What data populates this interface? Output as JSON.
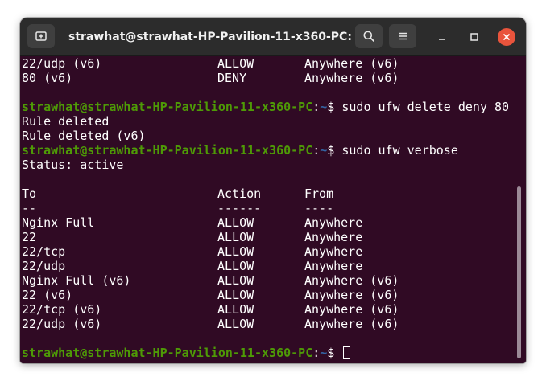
{
  "window": {
    "title": "strawhat@strawhat-HP-Pavilion-11-x360-PC: ~"
  },
  "prompt": {
    "user_host": "strawhat@strawhat-HP-Pavilion-11-x360-PC",
    "colon": ":",
    "path": "~",
    "dollar": "$ "
  },
  "lines": [
    {
      "type": "row",
      "cols": [
        "22/udp (v6)",
        "ALLOW",
        "Anywhere (v6)"
      ]
    },
    {
      "type": "row",
      "cols": [
        "80 (v6)",
        "DENY",
        "Anywhere (v6)"
      ]
    },
    {
      "type": "blank"
    },
    {
      "type": "cmd",
      "command": "sudo ufw delete deny 80"
    },
    {
      "type": "text",
      "text": "Rule deleted"
    },
    {
      "type": "text",
      "text": "Rule deleted (v6)"
    },
    {
      "type": "cmd",
      "command": "sudo ufw verbose"
    },
    {
      "type": "text",
      "text": "Status: active"
    },
    {
      "type": "blank"
    },
    {
      "type": "row",
      "cols": [
        "To",
        "Action",
        "From"
      ]
    },
    {
      "type": "row",
      "cols": [
        "--",
        "------",
        "----"
      ]
    },
    {
      "type": "row",
      "cols": [
        "Nginx Full",
        "ALLOW",
        "Anywhere"
      ]
    },
    {
      "type": "row",
      "cols": [
        "22",
        "ALLOW",
        "Anywhere"
      ]
    },
    {
      "type": "row",
      "cols": [
        "22/tcp",
        "ALLOW",
        "Anywhere"
      ]
    },
    {
      "type": "row",
      "cols": [
        "22/udp",
        "ALLOW",
        "Anywhere"
      ]
    },
    {
      "type": "row",
      "cols": [
        "Nginx Full (v6)",
        "ALLOW",
        "Anywhere (v6)"
      ]
    },
    {
      "type": "row",
      "cols": [
        "22 (v6)",
        "ALLOW",
        "Anywhere (v6)"
      ]
    },
    {
      "type": "row",
      "cols": [
        "22/tcp (v6)",
        "ALLOW",
        "Anywhere (v6)"
      ]
    },
    {
      "type": "row",
      "cols": [
        "22/udp (v6)",
        "ALLOW",
        "Anywhere (v6)"
      ]
    },
    {
      "type": "blank"
    },
    {
      "type": "cmd",
      "command": "",
      "cursor": true
    }
  ],
  "colors": {
    "terminal_bg": "#300a24",
    "prompt_user": "#4e9a06",
    "prompt_path": "#3465a4",
    "titlebar_bg": "#2c2c2c",
    "close_button": "#e9543c"
  },
  "icons": {
    "new_tab": "new-tab-icon",
    "search": "search-icon",
    "menu": "hamburger-menu-icon",
    "minimize": "minimize-icon",
    "maximize": "maximize-icon",
    "close": "close-icon"
  }
}
